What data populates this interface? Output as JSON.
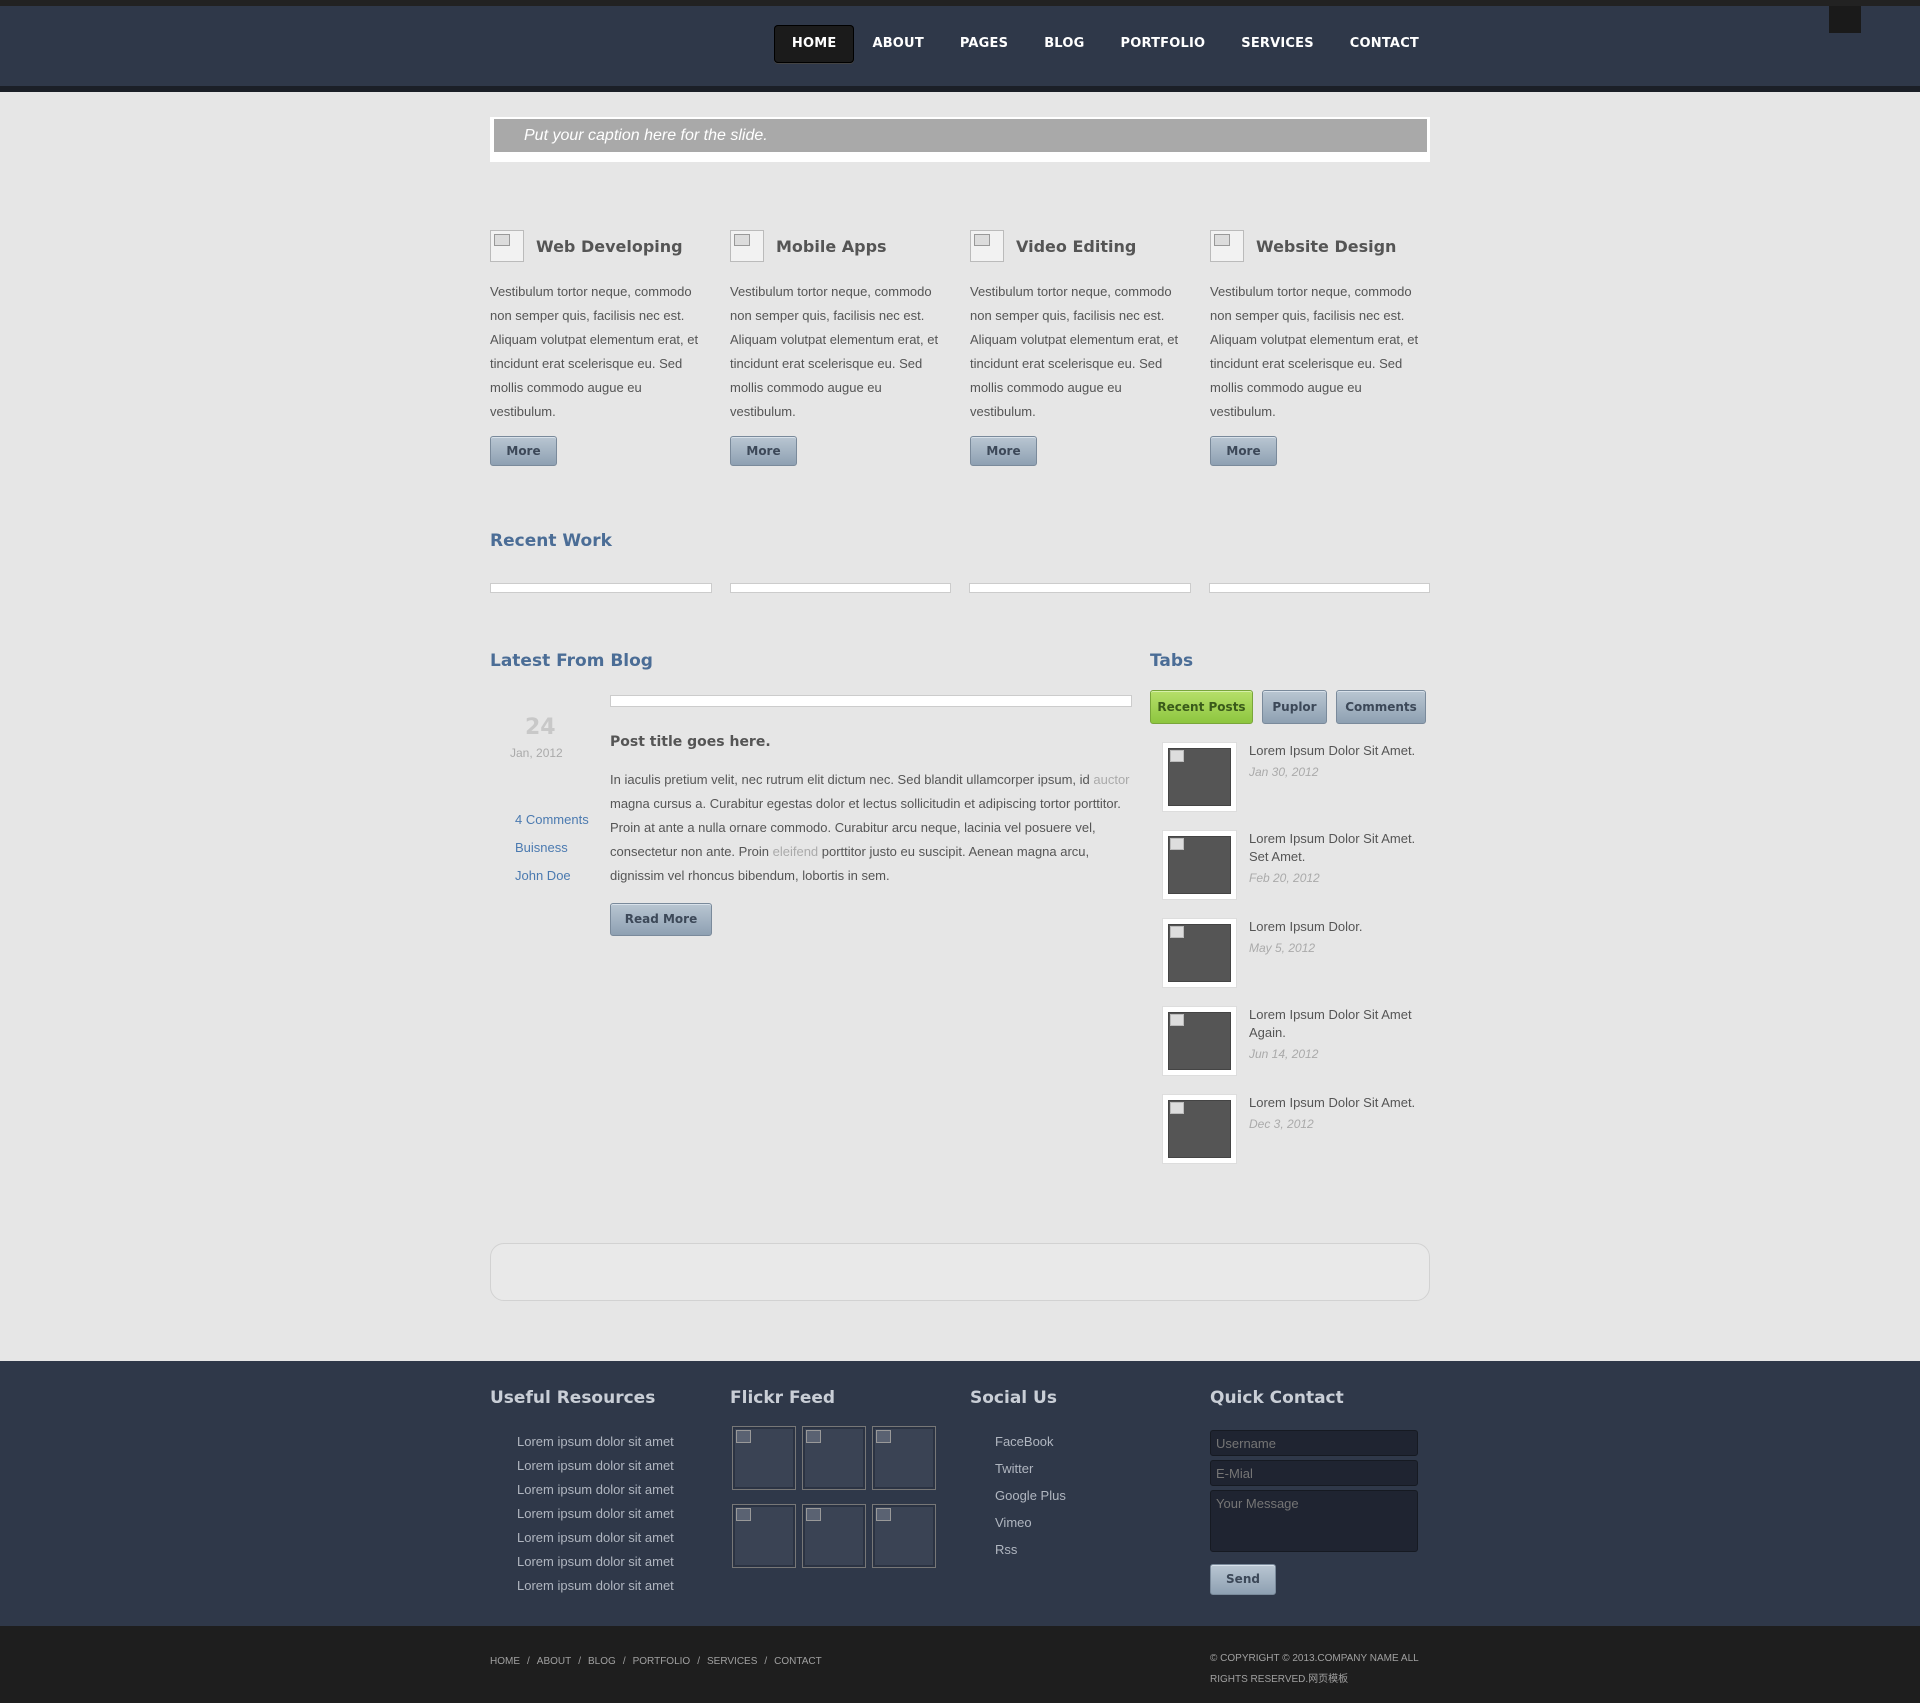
{
  "nav": {
    "items": [
      "HOME",
      "ABOUT",
      "PAGES",
      "BLOG",
      "PORTFOLIO",
      "SERVICES",
      "CONTACT"
    ],
    "active": "HOME"
  },
  "slider": {
    "caption": "Put your caption here for the slide."
  },
  "services": [
    {
      "title": "Web Developing",
      "text": "Vestibulum tortor neque, commodo non semper quis, facilisis nec est. Aliquam volutpat elementum erat, et tincidunt erat scelerisque eu. Sed mollis commodo augue eu vestibulum.",
      "button": "More"
    },
    {
      "title": "Mobile Apps",
      "text": "Vestibulum tortor neque, commodo non semper quis, facilisis nec est. Aliquam volutpat elementum erat, et tincidunt erat scelerisque eu. Sed mollis commodo augue eu vestibulum.",
      "button": "More"
    },
    {
      "title": "Video Editing",
      "text": "Vestibulum tortor neque, commodo non semper quis, facilisis nec est. Aliquam volutpat elementum erat, et tincidunt erat scelerisque eu. Sed mollis commodo augue eu vestibulum.",
      "button": "More"
    },
    {
      "title": "Website Design",
      "text": "Vestibulum tortor neque, commodo non semper quis, facilisis nec est. Aliquam volutpat elementum erat, et tincidunt erat scelerisque eu. Sed mollis commodo augue eu vestibulum.",
      "button": "More"
    }
  ],
  "recent_work": {
    "title": "Recent Work"
  },
  "blog": {
    "title": "Latest From Blog",
    "day": "24",
    "month_year": "Jan, 2012",
    "comments": "4 Comments",
    "category": "Buisness",
    "author": "John Doe",
    "post_title": "Post title goes here.",
    "text_1": "In iaculis pretium velit, nec rutrum elit dictum nec. Sed blandit ullamcorper ipsum, id ",
    "link_1": "auctor",
    "text_2": " magna cursus a. Curabitur egestas dolor et lectus sollicitudin et adipiscing tortor porttitor. Proin at ante a nulla ornare commodo. Curabitur arcu neque, lacinia vel posuere vel, consectetur non ante. Proin ",
    "link_2": "eleifend",
    "text_3": " porttitor justo eu suscipit. Aenean magna arcu, dignissim vel rhoncus bibendum, lobortis in sem.",
    "read_more": "Read More"
  },
  "tabs": {
    "title": "Tabs",
    "labels": [
      "Recent Posts",
      "Puplor",
      "Comments"
    ],
    "active": "Recent Posts",
    "posts": [
      {
        "title": "Lorem Ipsum Dolor Sit Amet.",
        "date": "Jan 30, 2012"
      },
      {
        "title": "Lorem Ipsum Dolor Sit Amet. Set Amet.",
        "date": "Feb 20, 2012"
      },
      {
        "title": "Lorem Ipsum Dolor.",
        "date": "May 5, 2012"
      },
      {
        "title": "Lorem Ipsum Dolor Sit Amet Again.",
        "date": "Jun 14, 2012"
      },
      {
        "title": "Lorem Ipsum Dolor Sit Amet.",
        "date": "Dec 3, 2012"
      }
    ]
  },
  "footer": {
    "resources": {
      "title": "Useful Resources",
      "items": [
        "Lorem ipsum dolor sit amet",
        "Lorem ipsum dolor sit amet",
        "Lorem ipsum dolor sit amet",
        "Lorem ipsum dolor sit amet",
        "Lorem ipsum dolor sit amet",
        "Lorem ipsum dolor sit amet",
        "Lorem ipsum dolor sit amet"
      ]
    },
    "flickr": {
      "title": "Flickr Feed"
    },
    "social": {
      "title": "Social Us",
      "items": [
        "FaceBook",
        "Twitter",
        "Google Plus",
        "Vimeo",
        "Rss"
      ]
    },
    "contact": {
      "title": "Quick Contact",
      "username_placeholder": "Username",
      "email_placeholder": "E-Mial",
      "message_placeholder": "Your Message",
      "send": "Send"
    }
  },
  "bottom": {
    "nav": [
      "HOME",
      "ABOUT",
      "BLOG",
      "PORTFOLIO",
      "SERVICES",
      "CONTACT"
    ],
    "copyright": "© COPYRIGHT © 2013.COMPANY NAME ALL RIGHTS RESERVED.网页模板"
  },
  "colors": {
    "header_bg": "#2f3849",
    "accent_blue": "#4b6d96",
    "tab_active": "#8dc63f",
    "page_bg": "#e6e6e6"
  }
}
